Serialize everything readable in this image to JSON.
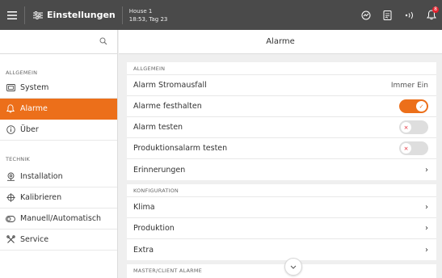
{
  "header": {
    "title": "Einstellungen",
    "house_name": "House 1",
    "house_time": "18:53, Tag 23",
    "notification_count": "8"
  },
  "sidebar": {
    "search_icon": "search-icon",
    "sections": [
      {
        "title": "ALLGEMEIN",
        "items": [
          {
            "label": "System",
            "icon": "monitor-icon",
            "active": false
          },
          {
            "label": "Alarme",
            "icon": "bell-icon",
            "active": true
          },
          {
            "label": "Über",
            "icon": "info-icon",
            "active": false
          }
        ]
      },
      {
        "title": "TECHNIK",
        "items": [
          {
            "label": "Installation",
            "icon": "installation-icon"
          },
          {
            "label": "Kalibrieren",
            "icon": "crosshair-icon"
          },
          {
            "label": "Manuell/Automatisch",
            "icon": "toggle-icon"
          },
          {
            "label": "Service",
            "icon": "tools-icon"
          }
        ]
      }
    ]
  },
  "main": {
    "title": "Alarme",
    "general": {
      "title": "ALLGEMEIN",
      "rows": [
        {
          "label": "Alarm Stromausfall",
          "value": "Immer Ein"
        },
        {
          "label": "Alarme festhalten",
          "toggle": "on"
        },
        {
          "label": "Alarm testen",
          "toggle": "off"
        },
        {
          "label": "Produktionsalarm testen",
          "toggle": "off"
        },
        {
          "label": "Erinnerungen"
        }
      ]
    },
    "config": {
      "title": "KONFIGURATION",
      "rows": [
        {
          "label": "Klima"
        },
        {
          "label": "Produktion"
        },
        {
          "label": "Extra"
        }
      ]
    },
    "master": {
      "title": "MASTER/CLIENT ALARME"
    }
  },
  "colors": {
    "accent": "#ec6f1a",
    "topbar": "#4a4a4a",
    "alert": "#e4222e"
  }
}
